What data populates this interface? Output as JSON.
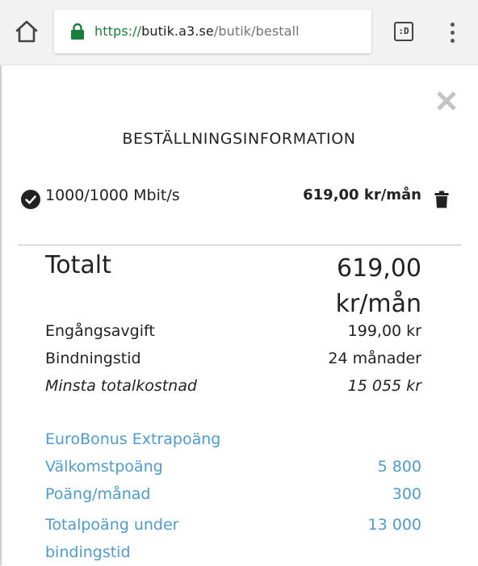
{
  "browser": {
    "url_scheme": "https://",
    "url_host": "butik.a3.se",
    "url_path": "/butik/bestall",
    "tabs_label": ":D"
  },
  "modal": {
    "title": "BESTÄLLNINGSINFORMATION",
    "item": {
      "name": "1000/1000 Mbit/s",
      "price": "619,00 kr/mån"
    },
    "total": {
      "label": "Totalt",
      "amount": "619,00",
      "unit": "kr/mån"
    },
    "fees": [
      {
        "label": "Engångsavgift",
        "value": "199,00 kr"
      },
      {
        "label": "Bindningstid",
        "value": "24 månader"
      },
      {
        "label": "Minsta totalkostnad",
        "value": "15 055 kr"
      }
    ],
    "bonus": {
      "heading": "EuroBonus Extrapoäng",
      "rows": [
        {
          "label": "Välkomstpoäng",
          "value": "5 800"
        },
        {
          "label": "Poäng/månad",
          "value": "300"
        },
        {
          "label": "Totalpoäng under bindingstid",
          "value": "13 000"
        }
      ]
    }
  },
  "colors": {
    "accent_blue": "#4b9cd3",
    "secure_green": "#188038",
    "text_dark": "#222222"
  },
  "icons": [
    "home-icon",
    "lock-icon",
    "tabs-icon",
    "menu-icon",
    "close-icon",
    "check-circle-icon",
    "trash-icon"
  ]
}
